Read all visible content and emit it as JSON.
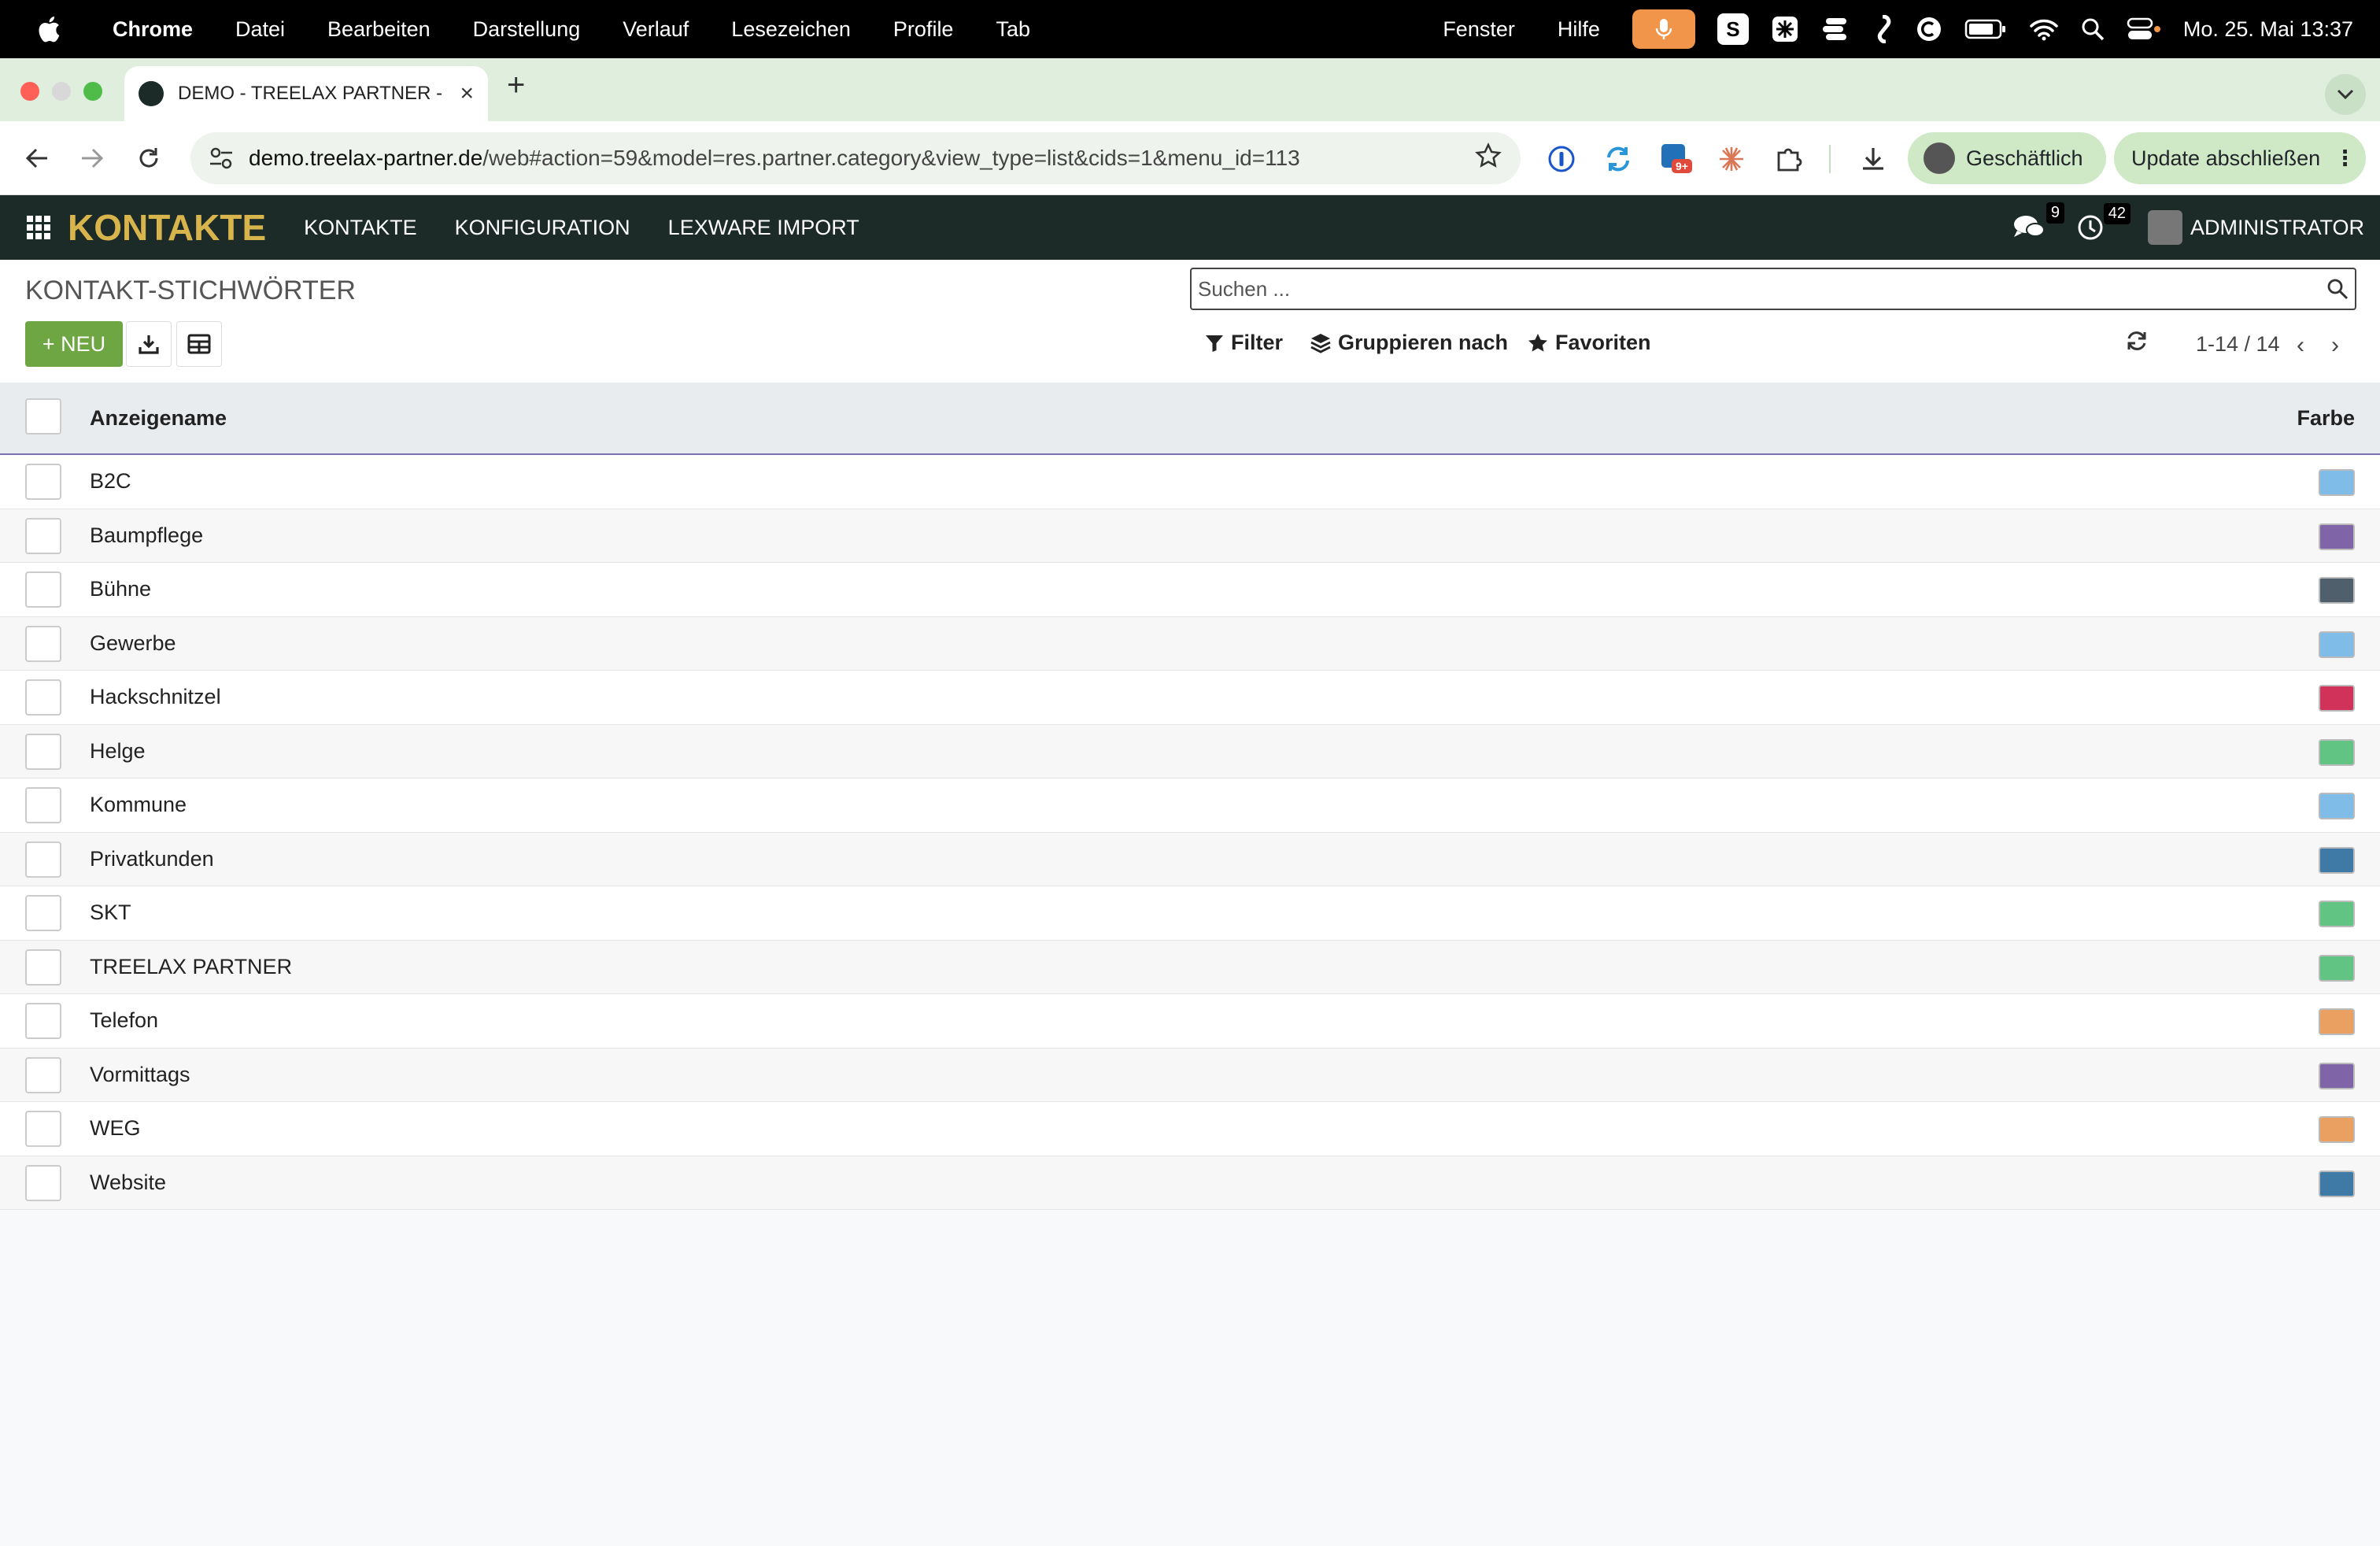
{
  "menubar": {
    "app": "Chrome",
    "items": [
      "Datei",
      "Bearbeiten",
      "Darstellung",
      "Verlauf",
      "Lesezeichen",
      "Profile",
      "Tab"
    ],
    "right_items": [
      "Fenster",
      "Hilfe"
    ],
    "tray_letter": "S",
    "clock": "Mo. 25. Mai  13:37"
  },
  "tab": {
    "title": "DEMO - TREELAX PARTNER - ",
    "new_tab": "+",
    "close": "×"
  },
  "omnibox": {
    "host": "demo.treelax-partner.de",
    "path": "/web#action=59&model=res.partner.category&view_type=list&cids=1&menu_id=113"
  },
  "profile": {
    "label": "Geschäftlich"
  },
  "update": {
    "label": "Update abschließen",
    "dots": "⋮"
  },
  "extensions": {
    "badge": "9+"
  },
  "appbar": {
    "brand": "KONTAKTE",
    "menus": [
      "KONTAKTE",
      "KONFIGURATION",
      "LEXWARE IMPORT"
    ],
    "chat_count": "9",
    "activity_count": "42",
    "user": "ADMINISTRATOR"
  },
  "control": {
    "title": "KONTAKT-STICHWÖRTER",
    "new_label": "+ NEU",
    "search_placeholder": "Suchen ...",
    "filter": "Filter",
    "group_by": "Gruppieren nach",
    "favorites": "Favoriten",
    "pager": "1-14 / 14",
    "prev": "‹",
    "next": "›"
  },
  "list": {
    "col_name": "Anzeigename",
    "col_color": "Farbe",
    "rows": [
      {
        "name": "B2C",
        "color": "#7fbde8"
      },
      {
        "name": "Baumpflege",
        "color": "#7f64a8"
      },
      {
        "name": "Bühne",
        "color": "#4f5f6b"
      },
      {
        "name": "Gewerbe",
        "color": "#7fbde8"
      },
      {
        "name": "Hackschnitzel",
        "color": "#d1325a"
      },
      {
        "name": "Helge",
        "color": "#62c483"
      },
      {
        "name": "Kommune",
        "color": "#7fbde8"
      },
      {
        "name": "Privatkunden",
        "color": "#3f7aa6"
      },
      {
        "name": "SKT",
        "color": "#62c483"
      },
      {
        "name": "TREELAX PARTNER",
        "color": "#62c483"
      },
      {
        "name": "Telefon",
        "color": "#eaa061"
      },
      {
        "name": "Vormittags",
        "color": "#7f64a8"
      },
      {
        "name": "WEG",
        "color": "#eaa061"
      },
      {
        "name": "Website",
        "color": "#3f7aa6"
      }
    ]
  }
}
